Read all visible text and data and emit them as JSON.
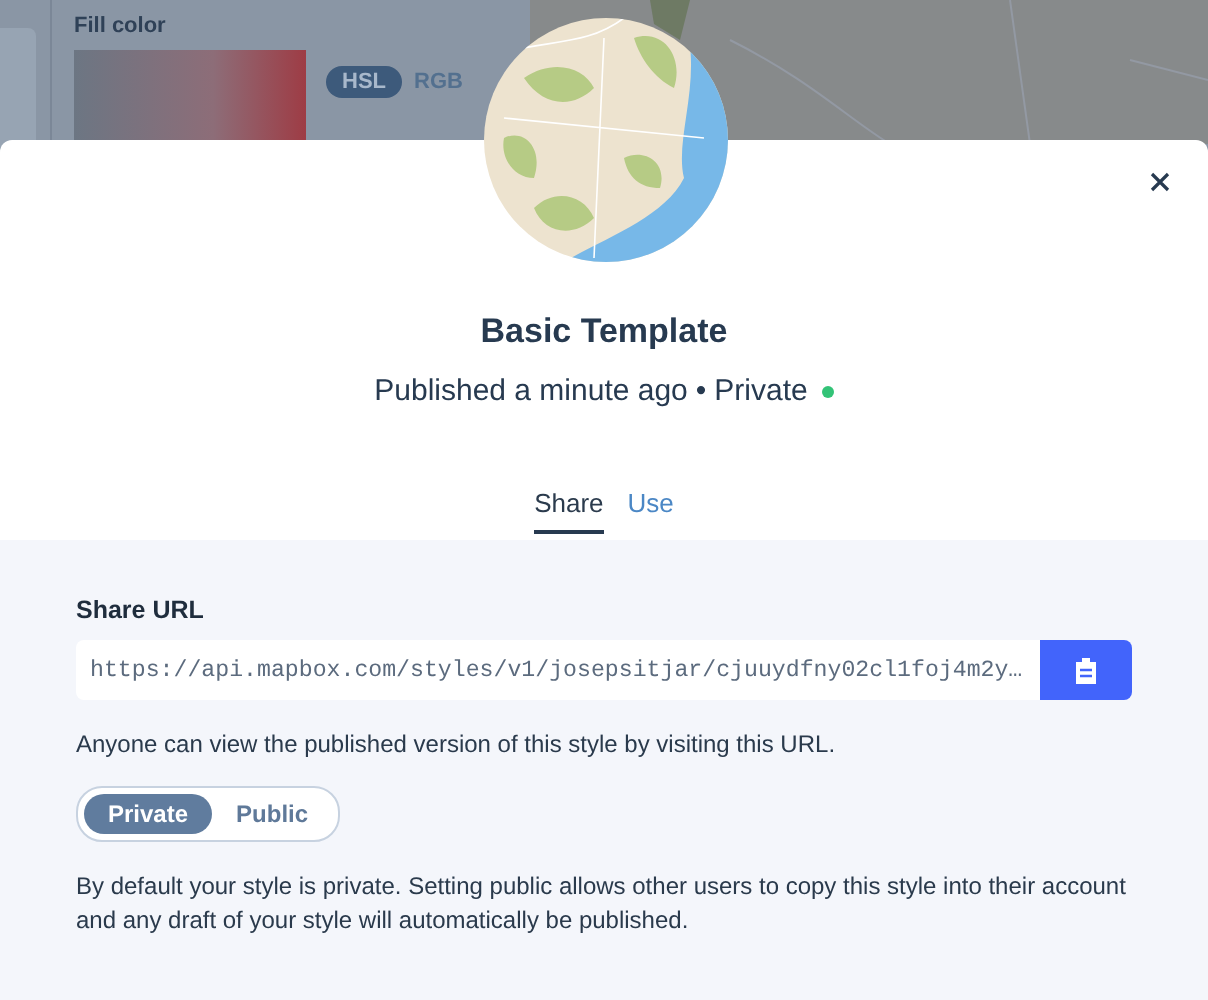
{
  "background": {
    "panel_title": "Fill color",
    "color_modes": [
      {
        "label": "HSL",
        "selected": true
      },
      {
        "label": "RGB",
        "selected": false
      }
    ]
  },
  "modal": {
    "title": "Basic Template",
    "status": "Published a minute ago",
    "separator": "•",
    "visibility": "Private",
    "status_dot": {
      "color": "#33c377"
    },
    "tabs": [
      {
        "label": "Share",
        "selected": true
      },
      {
        "label": "Use",
        "selected": false
      }
    ],
    "share_url": {
      "label": "Share URL",
      "value": "https://api.mapbox.com/styles/v1/josepsitjar/cjuuydfny02cl1foj4m2y…"
    },
    "share_note": "Anyone can view the published version of this style by visiting this URL.",
    "privacy_options": [
      {
        "label": "Private",
        "selected": true
      },
      {
        "label": "Public",
        "selected": false
      }
    ],
    "privacy_note": "By default your style is private. Setting public allows other users to copy this style into their account and any draft of your style will automatically be published."
  }
}
